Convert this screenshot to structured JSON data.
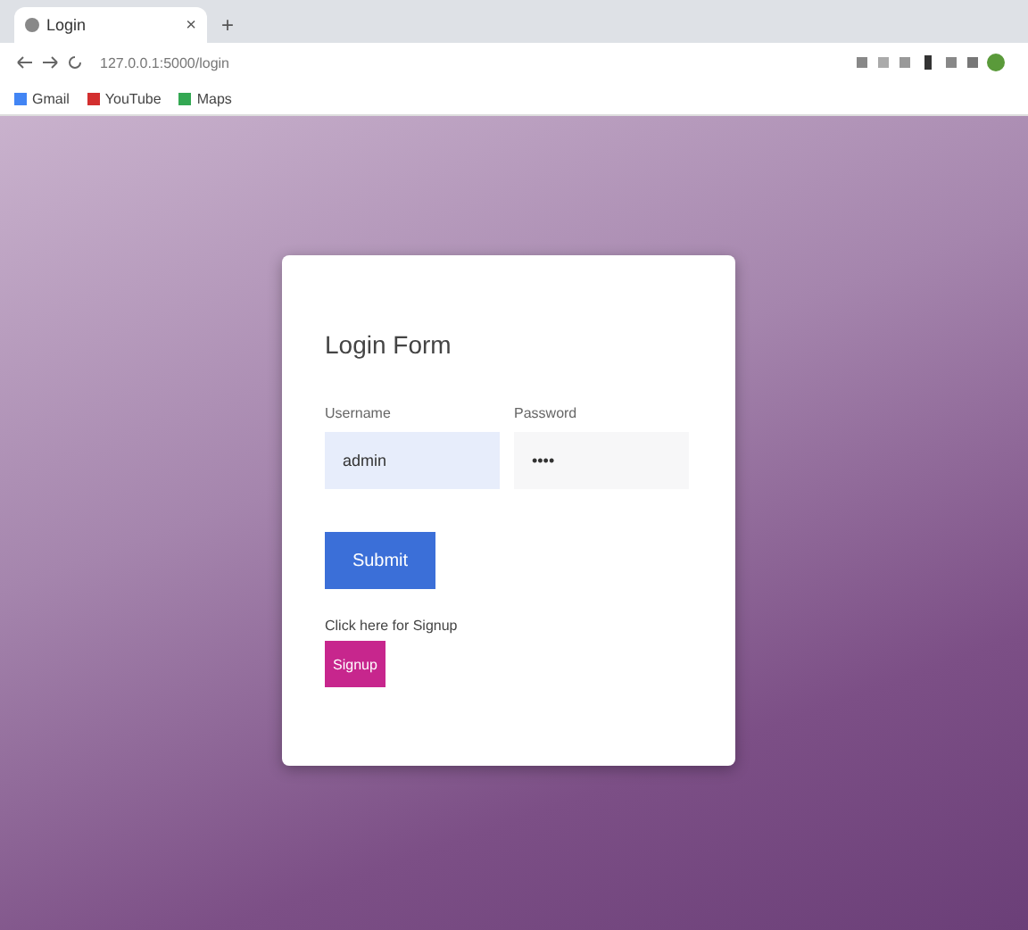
{
  "browser": {
    "tab_title": "Login",
    "close": "×",
    "new_tab": "+",
    "url": "127.0.0.1:5000/login",
    "bookmarks": [
      {
        "label": "Gmail",
        "color": "#4285f4"
      },
      {
        "label": "YouTube",
        "color": "#d32f2f"
      },
      {
        "label": "Maps",
        "color": "#34a853"
      }
    ]
  },
  "form": {
    "title": "Login Form",
    "fields": [
      {
        "label": "Username",
        "value": "admin",
        "filled": true
      },
      {
        "label": "Password",
        "value": "••••",
        "filled": false
      }
    ],
    "submit": "Submit",
    "signup_text": "Click here for Signup",
    "signup_button": "Signup"
  }
}
